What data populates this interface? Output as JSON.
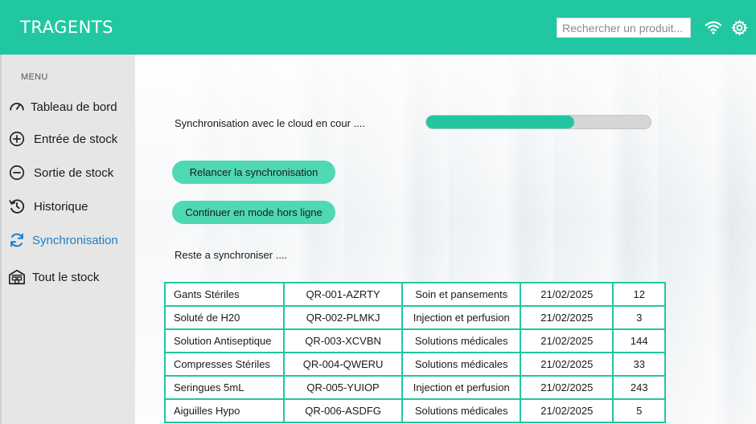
{
  "app": {
    "title": "TRAGENTS"
  },
  "header": {
    "search_placeholder": "Rechercher un produit...",
    "icons": [
      "wifi-icon",
      "gear-icon"
    ]
  },
  "colors": {
    "accent": "#21c7a1",
    "button": "#4fd8b4",
    "active_nav": "#1d7fc7",
    "sidebar": "#e6e6e6"
  },
  "sidebar": {
    "menu_label": "MENU",
    "items": [
      {
        "label": "Tableau de bord",
        "icon": "dashboard-gauge-icon"
      },
      {
        "label": "Entrée de stock",
        "icon": "plus-circle-icon"
      },
      {
        "label": "Sortie de stock",
        "icon": "minus-circle-icon"
      },
      {
        "label": "Historique",
        "icon": "history-icon"
      },
      {
        "label": "Synchronisation",
        "icon": "sync-icon",
        "active": true
      },
      {
        "label": "Tout le stock",
        "icon": "warehouse-icon"
      }
    ]
  },
  "sync": {
    "status_text": "Synchronisation avec le cloud en cour ....",
    "progress": 0.66,
    "relaunch_label": "Relancer la synchronisation",
    "offline_label": "Continuer en mode hors ligne",
    "remaining_text": "Reste a synchroniser ...."
  },
  "table": {
    "rows": [
      [
        "Gants Stériles",
        "QR-001-AZRTY",
        "Soin et pansements",
        "21/02/2025",
        "12"
      ],
      [
        "Soluté de H20",
        "QR-002-PLMKJ",
        "Injection et perfusion",
        "21/02/2025",
        "3"
      ],
      [
        "Solution Antiseptique",
        "QR-003-XCVBN",
        "Solutions médicales",
        "21/02/2025",
        "144"
      ],
      [
        "Compresses Stériles",
        "QR-004-QWERU",
        "Solutions médicales",
        "21/02/2025",
        "33"
      ],
      [
        "Seringues 5mL",
        "QR-005-YUIOP",
        "Injection et perfusion",
        "21/02/2025",
        "243"
      ],
      [
        "Aiguilles Hypo",
        "QR-006-ASDFG",
        "Solutions médicales",
        "21/02/2025",
        "5"
      ]
    ]
  }
}
